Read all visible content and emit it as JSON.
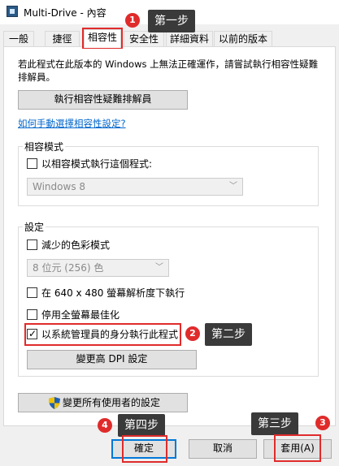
{
  "window": {
    "title": "Multi-Drive - 內容"
  },
  "tabs": [
    {
      "label": "一般"
    },
    {
      "label": "捷徑"
    },
    {
      "label": "相容性"
    },
    {
      "label": "安全性"
    },
    {
      "label": "詳細資料"
    },
    {
      "label": "以前的版本"
    }
  ],
  "description": "若此程式在此版本的 Windows 上無法正確運作，請嘗試執行相容性疑難排解員。",
  "troubleshooter_button": "執行相容性疑難排解員",
  "manual_link": "如何手動選擇相容性設定?",
  "compat_mode": {
    "group_label": "相容模式",
    "checkbox_label": "以相容模式執行這個程式:",
    "checked": false,
    "select_value": "Windows 8"
  },
  "settings": {
    "group_label": "設定",
    "reduced_color_label": "減少的色彩模式",
    "color_select_value": "8 位元 (256) 色",
    "res_640_label": "在 640 x 480 螢幕解析度下執行",
    "disable_fullscreen_label": "停用全螢幕最佳化",
    "run_as_admin_label": "以系統管理員的身分執行此程式",
    "run_as_admin_checked": true,
    "dpi_button": "變更高 DPI 設定"
  },
  "all_users_button": "變更所有使用者的設定",
  "footer": {
    "ok": "確定",
    "cancel": "取消",
    "apply": "套用(A)"
  },
  "annotations": {
    "step1": {
      "number": "1",
      "text": "第一步"
    },
    "step2": {
      "number": "2",
      "text": "第二步"
    },
    "step3": {
      "number": "3",
      "text": "第三步"
    },
    "step4": {
      "number": "4",
      "text": "第四步"
    },
    "color": "#e02b2b"
  },
  "icons": {
    "app": "drive-app-icon",
    "shield": "uac-shield-icon",
    "checkmark": "✓"
  }
}
